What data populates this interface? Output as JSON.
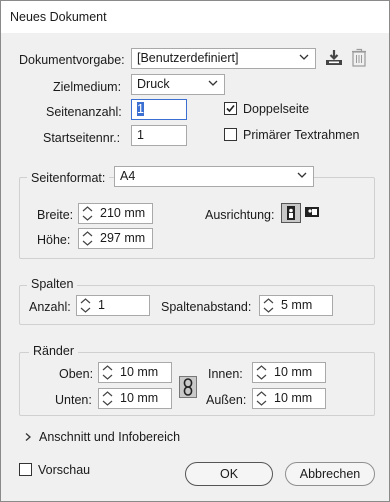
{
  "window": {
    "title": "Neues Dokument"
  },
  "preset": {
    "label": "Dokumentvorgabe:",
    "value": "[Benutzerdefiniert]",
    "save_icon": "save-preset-icon",
    "delete_icon": "trash-icon"
  },
  "intent": {
    "label": "Zielmedium:",
    "value": "Druck"
  },
  "pages": {
    "label": "Seitenanzahl:",
    "value": "1"
  },
  "start_page": {
    "label": "Startseitennr.:",
    "value": "1"
  },
  "facing": {
    "label": "Doppelseite",
    "checked": true
  },
  "primary_frame": {
    "label": "Primärer Textrahmen",
    "checked": false
  },
  "page_size": {
    "label": "Seitenformat:",
    "value": "A4",
    "width_label": "Breite:",
    "width": "210 mm",
    "height_label": "Höhe:",
    "height": "297 mm",
    "orientation_label": "Ausrichtung:",
    "orientation": "portrait"
  },
  "columns": {
    "title": "Spalten",
    "count_label": "Anzahl:",
    "count": "1",
    "gutter_label": "Spaltenabstand:",
    "gutter": "5 mm"
  },
  "margins": {
    "title": "Ränder",
    "top_label": "Oben:",
    "top": "10 mm",
    "bottom_label": "Unten:",
    "bottom": "10 mm",
    "inside_label": "Innen:",
    "inside": "10 mm",
    "outside_label": "Außen:",
    "outside": "10 mm",
    "link_icon": "chain-link-icon"
  },
  "bleed": {
    "label": "Anschnitt und Infobereich"
  },
  "preview": {
    "label": "Vorschau",
    "checked": false
  },
  "buttons": {
    "ok": "OK",
    "cancel": "Abbrechen"
  }
}
